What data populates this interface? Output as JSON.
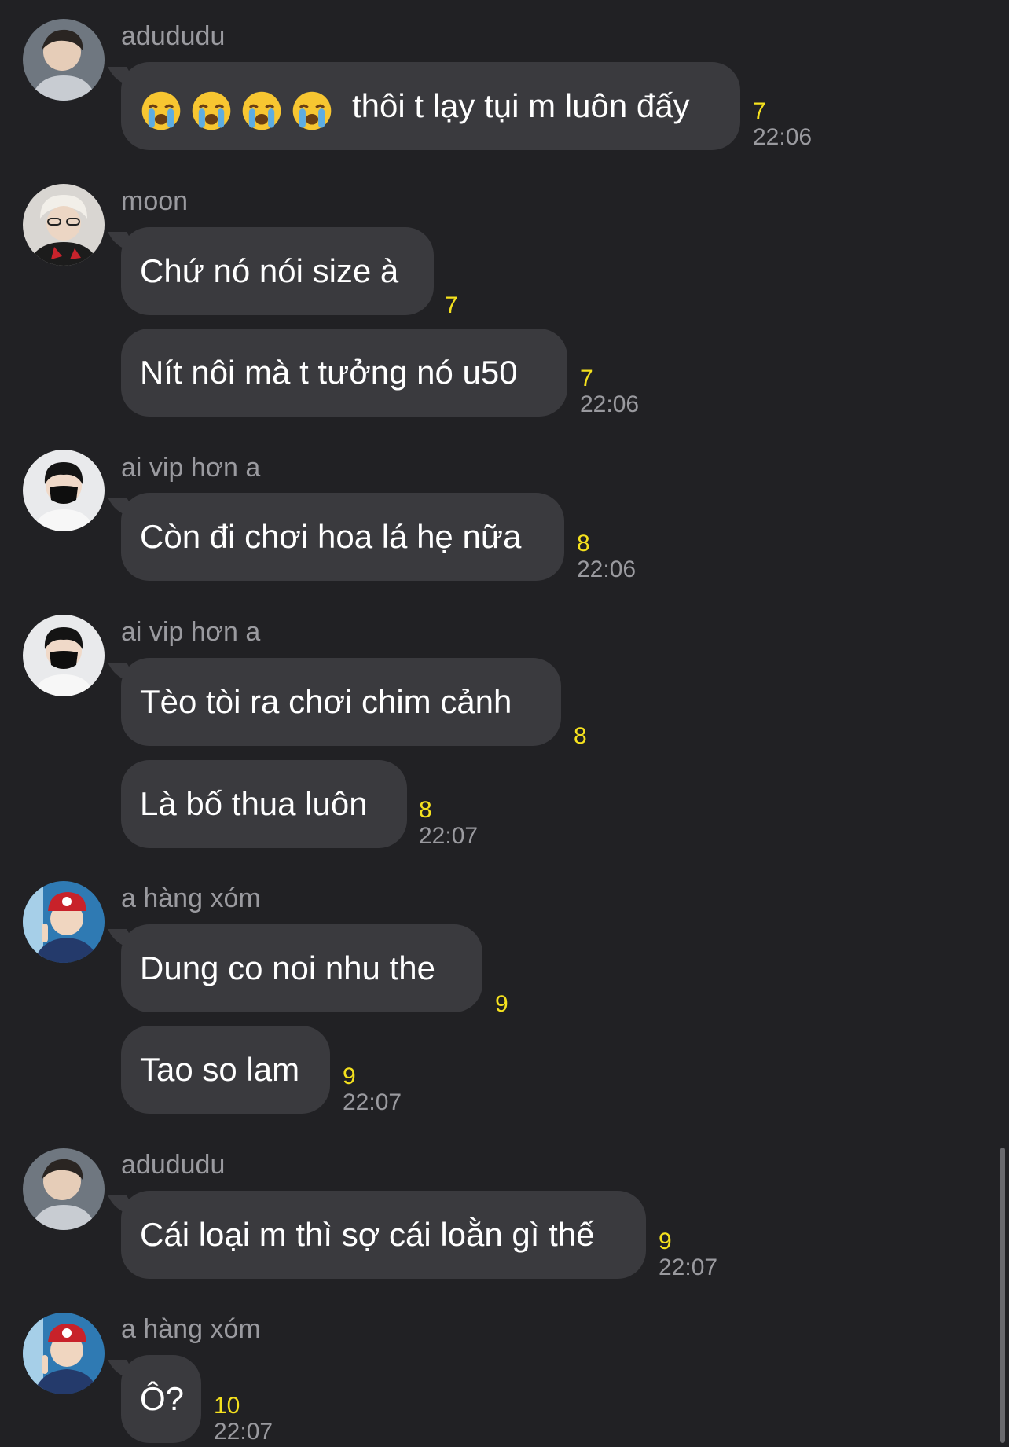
{
  "messages": [
    {
      "sender": "adududu",
      "text": "thôi t lạy tụi m luôn đấy",
      "emoji": [
        "loudly-crying-face-icon",
        "loudly-crying-face-icon",
        "loudly-crying-face-icon",
        "loudly-crying-face-icon"
      ],
      "count": "7",
      "time": "22:06"
    },
    {
      "sender": "moon",
      "text": "Chứ nó nói size à",
      "count": "7"
    },
    {
      "text": "Nít nôi mà t tưởng nó u50",
      "count": "7",
      "time": "22:06"
    },
    {
      "sender": "ai vip hơn a",
      "text": "Còn đi chơi hoa lá hẹ nữa",
      "count": "8",
      "time": "22:06"
    },
    {
      "sender": "ai vip hơn a",
      "text": "Tèo tòi ra chơi chim cảnh",
      "count": "8"
    },
    {
      "text": "Là bố thua luôn",
      "count": "8",
      "time": "22:07"
    },
    {
      "sender": "a hàng xóm",
      "text": "Dung co noi nhu the",
      "count": "9"
    },
    {
      "text": "Tao so lam",
      "count": "9",
      "time": "22:07"
    },
    {
      "sender": "adududu",
      "text": "Cái loại m thì sợ cái loằn gì thế",
      "count": "9",
      "time": "22:07"
    },
    {
      "sender": "a hàng xóm",
      "text": "Ô?",
      "count": "10",
      "time": "22:07"
    }
  ],
  "colors": {
    "bubble": "#3a3a3e",
    "background": "#212124",
    "count": "#f5e11e",
    "meta": "#9a9a9f"
  }
}
